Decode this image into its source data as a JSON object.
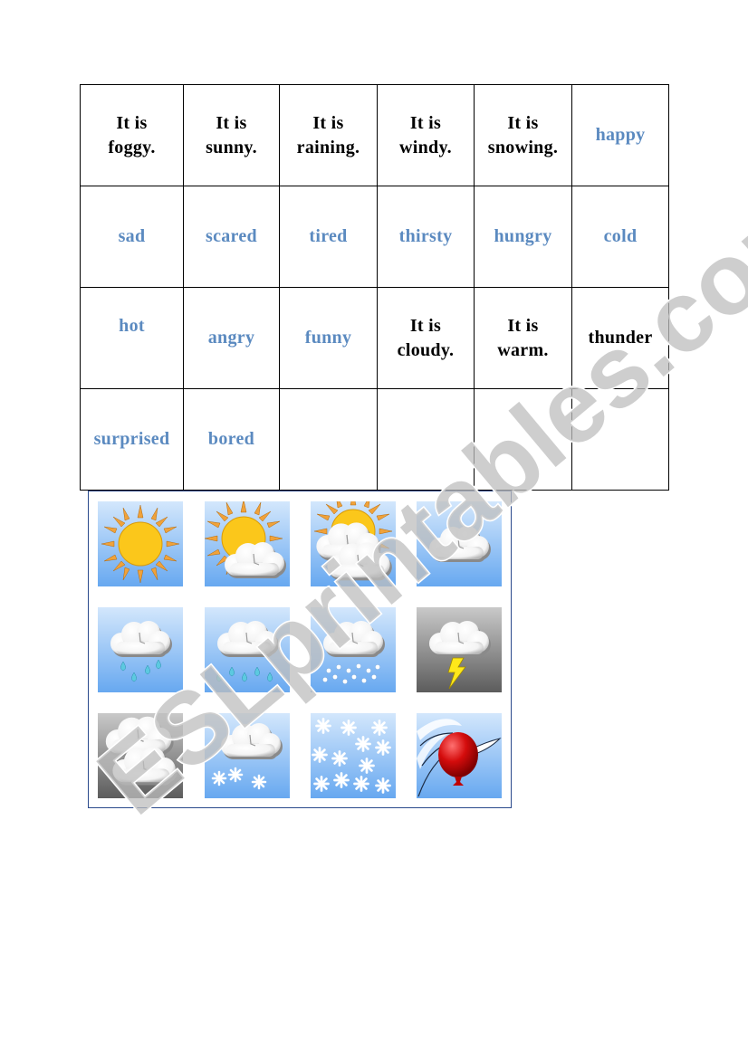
{
  "worksheet": {
    "table": {
      "rows": [
        [
          {
            "type": "weather",
            "lines": [
              "It is",
              "foggy."
            ]
          },
          {
            "type": "weather",
            "lines": [
              "It is",
              "sunny."
            ]
          },
          {
            "type": "weather",
            "lines": [
              "It is",
              "raining."
            ]
          },
          {
            "type": "weather",
            "lines": [
              "It is",
              "windy."
            ]
          },
          {
            "type": "weather",
            "lines": [
              "It is",
              "snowing."
            ]
          },
          {
            "type": "feeling",
            "lines": [
              "happy"
            ]
          }
        ],
        [
          {
            "type": "feeling",
            "lines": [
              "sad"
            ]
          },
          {
            "type": "feeling",
            "lines": [
              "scared"
            ]
          },
          {
            "type": "feeling",
            "lines": [
              "tired"
            ]
          },
          {
            "type": "feeling",
            "lines": [
              "thirsty"
            ]
          },
          {
            "type": "feeling",
            "lines": [
              "hungry"
            ]
          },
          {
            "type": "feeling",
            "lines": [
              "cold"
            ]
          }
        ],
        [
          {
            "type": "feeling",
            "lines": [
              "hot"
            ]
          },
          {
            "type": "feeling",
            "lines": [
              "angry"
            ]
          },
          {
            "type": "feeling",
            "lines": [
              "funny"
            ]
          },
          {
            "type": "weather",
            "lines": [
              "It is",
              "cloudy."
            ]
          },
          {
            "type": "weather",
            "lines": [
              "It is",
              "warm."
            ]
          },
          {
            "type": "weather",
            "lines": [
              "thunder"
            ]
          }
        ],
        [
          {
            "type": "feeling",
            "lines": [
              "surprised"
            ]
          },
          {
            "type": "feeling",
            "lines": [
              "bored"
            ]
          },
          {
            "type": "empty",
            "lines": []
          },
          {
            "type": "empty",
            "lines": []
          },
          {
            "type": "empty",
            "lines": []
          },
          {
            "type": "empty",
            "lines": []
          }
        ]
      ]
    },
    "icons": [
      [
        "sun-icon",
        "sun-behind-cloud-icon",
        "sun-behind-clouds-icon",
        "cloud-icon"
      ],
      [
        "rain-cloud-icon",
        "heavy-rain-cloud-icon",
        "hail-cloud-icon",
        "thunderstorm-icon"
      ],
      [
        "fog-clouds-icon",
        "snow-cloud-icon",
        "snowflakes-icon",
        "wind-balloon-icon"
      ]
    ],
    "watermark": "ESLprintables.com"
  },
  "colors": {
    "weather_text": "#000000",
    "feeling_text": "#5b8ac0",
    "frame_border": "#2a4a8c",
    "sky_top": "#cfe4fb",
    "sky_bottom": "#6aaaf0",
    "sun": "#fbc71b",
    "ray": "#f0a23a",
    "watermark": "#c8c8c8"
  }
}
